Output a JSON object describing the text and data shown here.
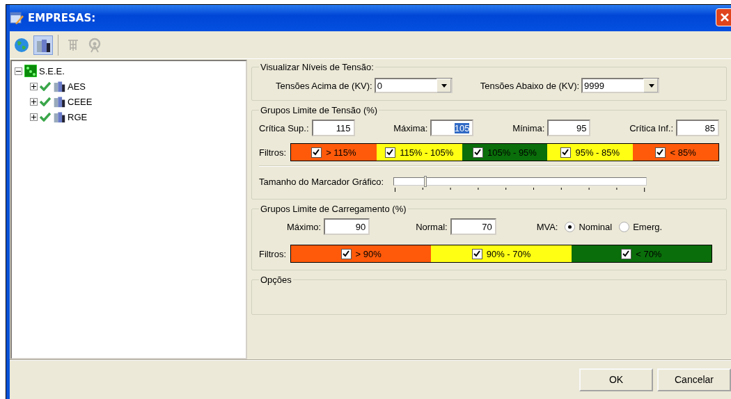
{
  "window": {
    "title": "EMPRESAS:"
  },
  "toolbar": [
    {
      "kind": "globe",
      "selected": false,
      "disabled": false
    },
    {
      "kind": "buildings",
      "selected": true,
      "disabled": false
    },
    {
      "kind": "substation",
      "selected": false,
      "disabled": true
    },
    {
      "kind": "antenna",
      "selected": false,
      "disabled": true
    }
  ],
  "tree": {
    "label": "S.E.E.",
    "expanded": true,
    "children": [
      {
        "label": "AES",
        "expanded": false,
        "checked": true
      },
      {
        "label": "CEEE",
        "expanded": false,
        "checked": true
      },
      {
        "label": "RGE",
        "expanded": false,
        "checked": true
      }
    ]
  },
  "voltage_levels": {
    "title": "Visualizar Níveis de Tensão:",
    "fields": [
      {
        "label": "Tensões Acima de (KV):",
        "value": "0"
      },
      {
        "label": "Tensões Abaixo de (KV):",
        "value": "9999"
      }
    ]
  },
  "voltage_limits": {
    "title": "Grupos Limite de Tensão (%)",
    "fields": [
      {
        "label": "Crítica Sup.:",
        "value": "115",
        "selected": false
      },
      {
        "label": "Máxima:",
        "value": "105",
        "selected": true
      },
      {
        "label": "Mínima:",
        "value": "95",
        "selected": false
      },
      {
        "label": "Crítica Inf.:",
        "value": "85",
        "selected": false
      }
    ],
    "filters_label": "Filtros:",
    "filters": [
      {
        "label": "> 115%",
        "checked": true,
        "color": "#ff5a0a"
      },
      {
        "label": "115% - 105%",
        "checked": true,
        "color": "#ffff14"
      },
      {
        "label": "105% - 95%",
        "checked": true,
        "color": "#0a6e0a"
      },
      {
        "label": "95% - 85%",
        "checked": true,
        "color": "#ffff14"
      },
      {
        "label": "< 85%",
        "checked": true,
        "color": "#ff5a0a"
      }
    ]
  },
  "marker_size": {
    "label": "Tamanho do Marcador Gráfico:",
    "level": 0.12
  },
  "load_limits": {
    "title": "Grupos Limite de Carregamento (%)",
    "fields": [
      {
        "label": "Máximo:",
        "value": "90"
      },
      {
        "label": "Normal:",
        "value": "70"
      }
    ],
    "mva_label": "MVA:",
    "options": [
      {
        "label": "Nominal",
        "selected": true
      },
      {
        "label": "Emerg.",
        "selected": false
      }
    ],
    "filters_label": "Filtros:",
    "filters": [
      {
        "label": "> 90%",
        "checked": true,
        "color": "#ff5a0a"
      },
      {
        "label": "90% - 70%",
        "checked": true,
        "color": "#ffff14"
      },
      {
        "label": "< 70%",
        "checked": true,
        "color": "#0a6e0a"
      }
    ]
  },
  "options_group": {
    "title": "Opções"
  },
  "buttons": [
    "OK",
    "Cancelar"
  ]
}
